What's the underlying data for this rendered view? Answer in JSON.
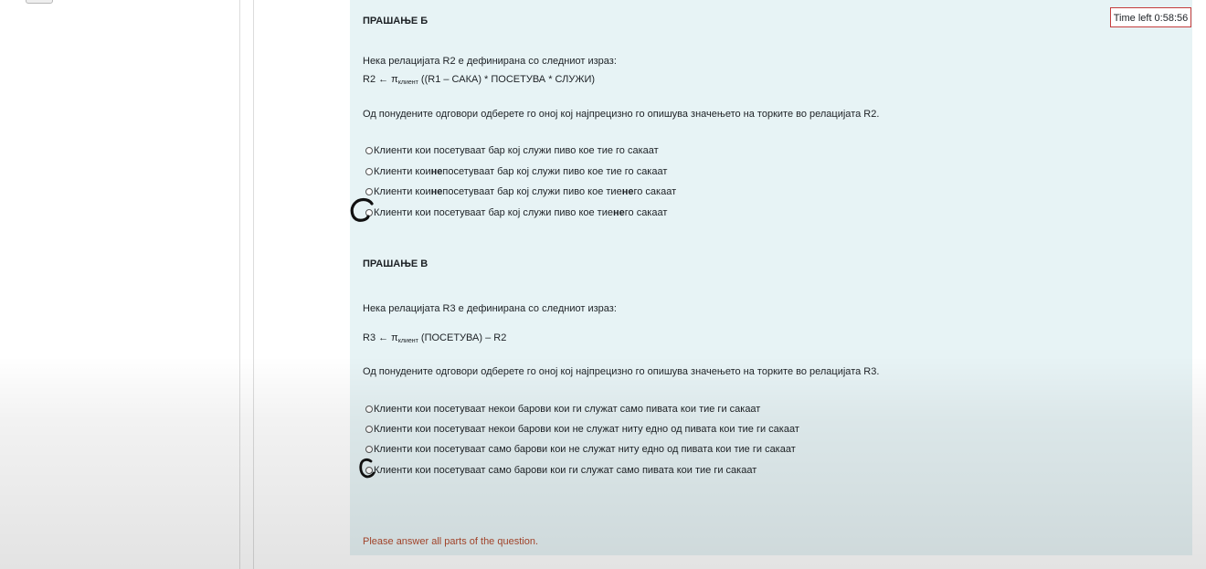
{
  "timer": {
    "label": "Time left 0:58:56"
  },
  "part_b": {
    "heading": "ПРАШАЊЕ Б",
    "intro": "Нека релацијата R2 е дефинирана со следниот израз:",
    "expr_lhs": "R2 ← π",
    "expr_sub": "клиент",
    "expr_rhs": " ((R1 – САКА) * ПОСЕТУВА * СЛУЖИ)",
    "prompt": "Од понудените одговори одберете го оној кој најпрецизно го опишува значењето на торките во релацијата R2.",
    "options": [
      {
        "pre": "Клиенти кои посетуваат бар кој служи пиво кое тие го сакаат"
      },
      {
        "pre": "Клиенти кои ",
        "b1": "не",
        "mid": " посетуваат бар кој служи пиво кое тие го сакаат"
      },
      {
        "pre": "Клиенти кои ",
        "b1": "не",
        "mid": " посетуваат бар кој служи пиво кое тие ",
        "b2": "не",
        "post": " го сакаат"
      },
      {
        "pre": "Клиенти кои посетуваат бар кој служи пиво кое тие ",
        "b1": "не",
        "mid": " го сакаат"
      }
    ]
  },
  "part_c": {
    "heading": "ПРАШАЊЕ В",
    "intro": "Нека релацијата R3 е дефинирана со следниот израз:",
    "expr_lhs": "R3 ← π",
    "expr_sub": "клиент",
    "expr_rhs": " (ПОСЕТУВА) – R2",
    "prompt": "Од понудените одговори одберете го оној кој најпрецизно го опишува значењето на торките во релацијата R3.",
    "options": [
      "Клиенти кои посетуваат некои барови кои ги служат само пивата кои тие ги сакаат",
      "Клиенти кои посетуваат некои барови кои не служат ниту едно од пивата кои тие ги сакаат",
      "Клиенти кои посетуваат само барови кои не служат ниту едно од пивата кои тие ги сакаат",
      "Клиенти кои посетуваат само барови кои ги служат само пивата кои тие ги сакаат"
    ]
  },
  "warning": "Please answer all parts of the question.",
  "colors": {
    "panel": "#e7f3f5",
    "timer_border": "#c43c3c",
    "warning": "#b24a2e",
    "ink": "#1d2125"
  },
  "icons": [
    "radio-icon",
    "handwritten-circle-mark"
  ]
}
